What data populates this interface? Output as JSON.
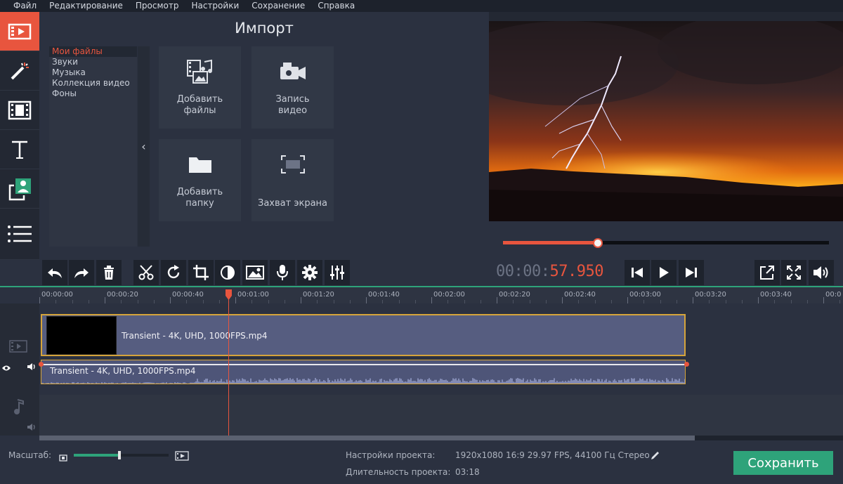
{
  "menu": [
    "Файл",
    "Редактирование",
    "Просмотр",
    "Настройки",
    "Сохранение",
    "Справка"
  ],
  "left_tools": [
    {
      "icon": "film-import-icon",
      "active": true
    },
    {
      "icon": "magic-wand-icon",
      "active": false
    },
    {
      "icon": "transitions-icon",
      "active": false
    },
    {
      "icon": "text-icon",
      "active": false
    },
    {
      "icon": "stickers-icon",
      "active": false
    },
    {
      "icon": "more-tools-icon",
      "active": false
    }
  ],
  "import": {
    "title": "Импорт",
    "files": [
      "Мои файлы",
      "Звуки",
      "Музыка",
      "Коллекция видео",
      "Фоны"
    ],
    "tiles": {
      "add_files": "Добавить\nфайлы",
      "record_video": "Запись\nвидео",
      "add_folder": "Добавить\nпапку",
      "screen_capture": "Захват экрана"
    }
  },
  "player": {
    "timecode_dim": "00:00:",
    "timecode_active": "57.950",
    "progress_percent": 29
  },
  "ruler_ticks": [
    "00:00:00",
    "00:00:20",
    "00:00:40",
    "00:01:00",
    "00:01:20",
    "00:01:40",
    "00:02:00",
    "00:02:20",
    "00:02:40",
    "00:03:00",
    "00:03:20",
    "00:03:40",
    "00:0"
  ],
  "timeline": {
    "video_clip": "Transient - 4K, UHD, 1000FPS.mp4",
    "audio_clip": "Transient - 4K, UHD, 1000FPS.mp4"
  },
  "bottom": {
    "scale_label": "Масштаб:",
    "project_settings_label": "Настройки проекта:",
    "project_settings_value": "1920x1080 16:9 29.97 FPS, 44100 Гц Стерео",
    "duration_label": "Длительность проекта:",
    "duration_value": "03:18",
    "zoom_level_percent": 48,
    "save_label": "Сохранить"
  },
  "colors": {
    "accent": "#e8553e",
    "green": "#2ea37a",
    "clip_border": "#d6a43a"
  }
}
